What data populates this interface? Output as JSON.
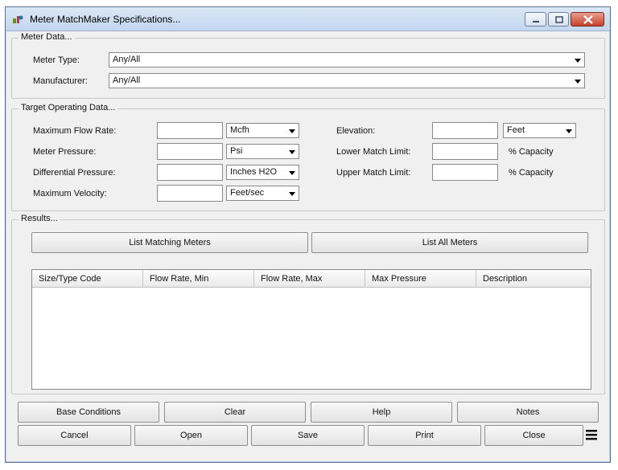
{
  "window": {
    "title": "Meter MatchMaker Specifications..."
  },
  "meter_data": {
    "legend": "Meter Data...",
    "meter_type_label": "Meter Type:",
    "meter_type_value": "Any/All",
    "manufacturer_label": "Manufacturer:",
    "manufacturer_value": "Any/All"
  },
  "target": {
    "legend": "Target Operating Data...",
    "max_flow_label": "Maximum Flow Rate:",
    "max_flow_unit": "Mcfh",
    "meter_pressure_label": "Meter Pressure:",
    "meter_pressure_unit": "Psi",
    "diff_pressure_label": "Differential Pressure:",
    "diff_pressure_unit": "Inches H2O",
    "max_velocity_label": "Maximum Velocity:",
    "max_velocity_unit": "Feet/sec",
    "elevation_label": "Elevation:",
    "elevation_unit": "Feet",
    "lower_limit_label": "Lower Match Limit:",
    "lower_limit_suffix": "% Capacity",
    "upper_limit_label": "Upper Match Limit:",
    "upper_limit_suffix": "% Capacity"
  },
  "results": {
    "legend": "Results...",
    "list_matching": "List Matching Meters",
    "list_all": "List All Meters",
    "columns": [
      "Size/Type Code",
      "Flow Rate, Min",
      "Flow Rate, Max",
      "Max Pressure",
      "Description"
    ]
  },
  "bottom": {
    "base_conditions": "Base Conditions",
    "clear": "Clear",
    "help": "Help",
    "notes": "Notes",
    "cancel": "Cancel",
    "open": "Open",
    "save": "Save",
    "print": "Print",
    "close": "Close"
  },
  "icons": {
    "app": "meter-app-icon",
    "minimize": "minimize-icon",
    "maximize": "maximize-icon",
    "close": "close-icon",
    "menu": "hamburger-menu-icon"
  }
}
